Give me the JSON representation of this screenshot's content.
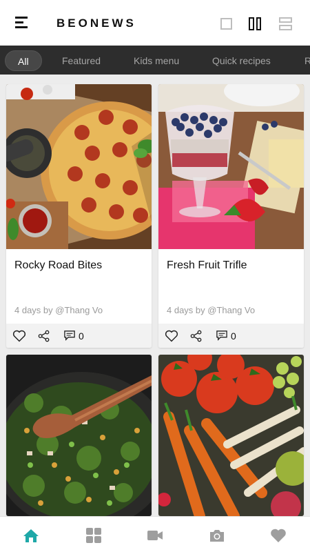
{
  "app": {
    "title": "BEONEWS"
  },
  "header": {
    "menu_icon": "hamburger-menu-icon",
    "view_icons": [
      "single-view-icon",
      "grid-view-icon",
      "list-view-icon"
    ]
  },
  "tabs": [
    {
      "label": "All",
      "active": true
    },
    {
      "label": "Featured",
      "active": false
    },
    {
      "label": "Kids menu",
      "active": false
    },
    {
      "label": "Quick recipes",
      "active": false
    },
    {
      "label": "R",
      "active": false
    }
  ],
  "cards": [
    {
      "title": "Rocky Road Bites",
      "meta": "4 days by @Thang Vo",
      "comments": "0"
    },
    {
      "title": "Fresh Fruit Trifle",
      "meta": "4 days by @Thang Vo",
      "comments": "0"
    },
    {
      "title": "",
      "meta": "",
      "comments": ""
    },
    {
      "title": "",
      "meta": "",
      "comments": ""
    }
  ],
  "bottom_nav": [
    {
      "icon": "home-icon",
      "active": true
    },
    {
      "icon": "grid-icon",
      "active": false
    },
    {
      "icon": "video-icon",
      "active": false
    },
    {
      "icon": "camera-icon",
      "active": false
    },
    {
      "icon": "heart-icon",
      "active": false
    }
  ],
  "colors": {
    "accent": "#1fa8a8",
    "tab_bar": "#2d2d2d",
    "icon_gray": "#9e9e9e"
  }
}
